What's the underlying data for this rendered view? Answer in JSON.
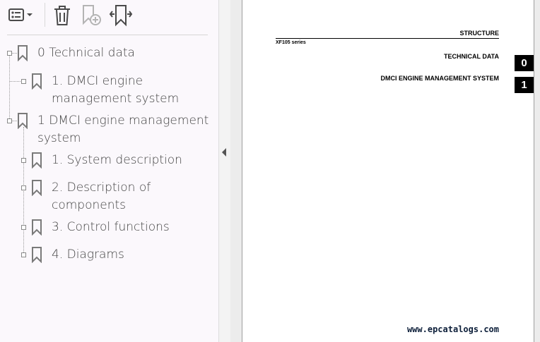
{
  "toolbar": {
    "icons": [
      "list-view-icon",
      "chevron-down-icon",
      "trash-icon",
      "add-bookmark-icon",
      "expand-bookmark-icon"
    ]
  },
  "bookmarks": [
    {
      "label": "0 Technical data",
      "level": 0
    },
    {
      "label": "1. DMCI engine management system",
      "level": 1
    },
    {
      "label": "1 DMCI engine management system",
      "level": 0
    },
    {
      "label": "1. System description",
      "level": 1
    },
    {
      "label": "2. Description of components",
      "level": 1
    },
    {
      "label": "3. Control functions",
      "level": 1
    },
    {
      "label": "4. Diagrams",
      "level": 1
    }
  ],
  "document": {
    "header_right": "STRUCTURE",
    "series": "XF105 series",
    "section": "TECHNICAL DATA",
    "subsection": "DMCI ENGINE MANAGEMENT SYSTEM",
    "tab_top": "0",
    "tab_bottom": "1",
    "footer_url": "www.epcatalogs.com"
  },
  "colors": {
    "sidebar_bg": "#fbf8fc",
    "viewer_bg": "#ececec",
    "tab_bg": "#000000"
  }
}
